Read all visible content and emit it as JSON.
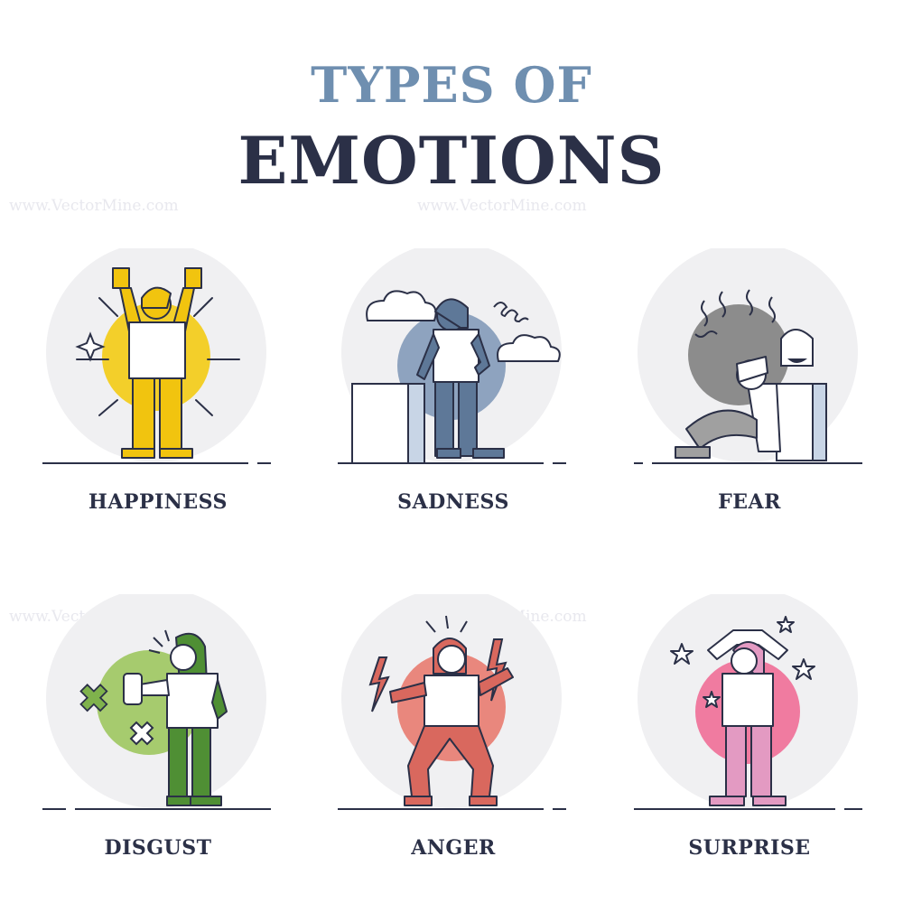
{
  "title": {
    "line1": "TYPES OF",
    "line2": "EMOTIONS"
  },
  "watermark": "www.VectorMine.com",
  "emotions": [
    {
      "label": "HAPPINESS",
      "accent": "#f3cf2a",
      "figure": "#f1c40f",
      "icon": "thumbs-up-person"
    },
    {
      "label": "SADNESS",
      "accent": "#8ea3bf",
      "figure": "#5e7898",
      "icon": "sad-person-with-clouds"
    },
    {
      "label": "FEAR",
      "accent": "#8c8c8c",
      "figure": "#a0a0a0",
      "icon": "scared-person-with-ghost"
    },
    {
      "label": "DISGUST",
      "accent": "#a6cb6e",
      "figure": "#4f8f34",
      "icon": "disgusted-person"
    },
    {
      "label": "ANGER",
      "accent": "#e9877d",
      "figure": "#d9685e",
      "icon": "angry-person-with-lightning"
    },
    {
      "label": "SURPRISE",
      "accent": "#f07ba0",
      "figure": "#e39ac2",
      "icon": "surprised-person-with-stars"
    }
  ]
}
